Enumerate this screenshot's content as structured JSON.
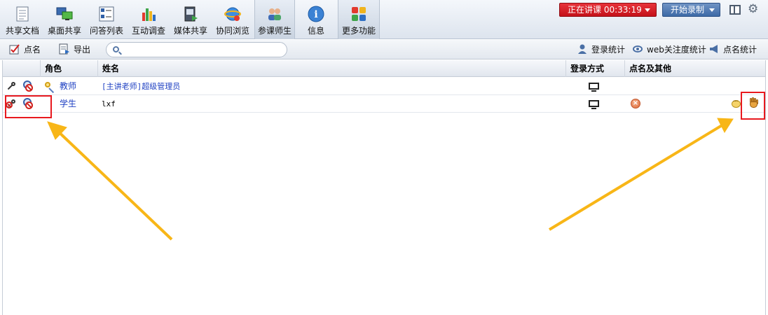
{
  "toolbar": {
    "items": [
      {
        "label": "共享文档",
        "icon": "document-icon"
      },
      {
        "label": "桌面共享",
        "icon": "desktop-share-icon"
      },
      {
        "label": "问答列表",
        "icon": "qa-list-icon"
      },
      {
        "label": "互动调查",
        "icon": "survey-chart-icon"
      },
      {
        "label": "媒体共享",
        "icon": "media-share-icon"
      },
      {
        "label": "协同浏览",
        "icon": "browser-icon"
      },
      {
        "label": "参课师生",
        "icon": "participants-icon"
      },
      {
        "label": "信息",
        "icon": "info-icon"
      },
      {
        "label": "更多功能",
        "icon": "more-functions-icon"
      }
    ],
    "live_status": "正在讲课 00:33:19",
    "record_label": "开始录制"
  },
  "subbar": {
    "roll_call": "点名",
    "export": "导出",
    "search_placeholder": "",
    "login_stats": "登录统计",
    "web_attention": "web关注度统计",
    "roll_call_stats": "点名统计"
  },
  "table": {
    "headers": {
      "role": "角色",
      "name": "姓名",
      "login": "登录方式",
      "rollcall": "点名及其他"
    },
    "rows": [
      {
        "role": "教师",
        "name": "[主讲老师]超级管理员"
      },
      {
        "role": "学生",
        "name": "lxf"
      }
    ]
  },
  "colors": {
    "live_red": "#d81e24",
    "record_blue": "#4a74ae",
    "annotation_red": "#e8191f",
    "arrow_yellow": "#f8b617",
    "link_blue": "#1d3fc2"
  }
}
